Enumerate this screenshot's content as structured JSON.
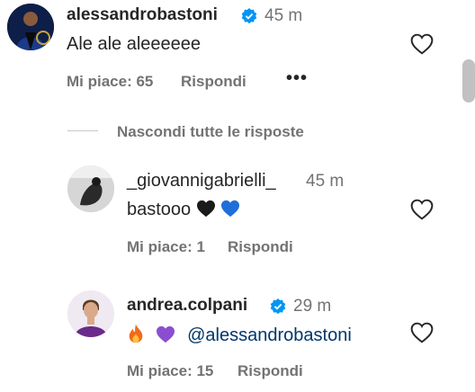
{
  "comments": [
    {
      "username": "alessandrobastoni",
      "verified": true,
      "time": "45 m",
      "text": "Ale ale aleeeeee",
      "likes": "Mi piace: 65",
      "reply": "Rispondi",
      "more": "•••",
      "avatar_icon": "avatar-inter-player"
    },
    {
      "username": "_giovannigabrielli_",
      "verified": false,
      "time": "45 m",
      "text": "bastooo",
      "emojis": [
        "black-heart",
        "blue-heart"
      ],
      "likes": "Mi piace: 1",
      "reply": "Rispondi"
    },
    {
      "username": "andrea.colpani",
      "verified": true,
      "time": "29 m",
      "emojis": [
        "fire",
        "purple-heart"
      ],
      "mention": "@alessandrobastoni",
      "likes": "Mi piace: 15",
      "reply": "Rispondi"
    }
  ],
  "hide_replies": "Nascondi tutte le risposte",
  "colors": {
    "verified": "#0095f6",
    "mention": "#00376b",
    "secondary_text": "#737373"
  }
}
